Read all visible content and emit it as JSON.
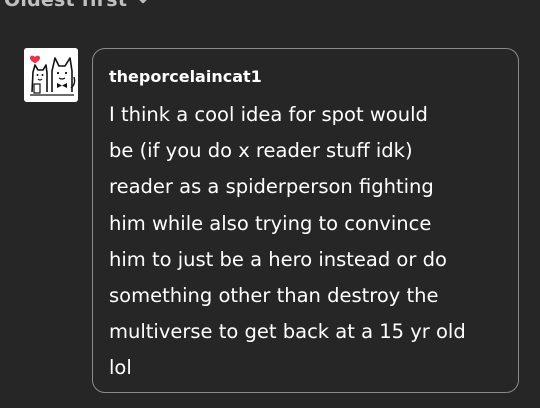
{
  "sort": {
    "label": "Oldest first",
    "icon": "chevron-down-icon"
  },
  "comment": {
    "avatar_icon": "cat-avatar-icon",
    "username": "theporcelaincat1",
    "text": "I think a cool idea for spot would\nbe (if you do x reader stuff idk)\nreader as a spiderperson fighting\nhim while also trying to convince\nhim to just be a hero instead or do\nsomething other than destroy the\nmultiverse to get back at a 15 yr old\nlol"
  },
  "colors": {
    "background": "#262626",
    "text": "#ffffff",
    "muted_text": "#bfbfbf",
    "bubble_border": "#8a8a8a",
    "avatar_heart": "#e8324a"
  }
}
